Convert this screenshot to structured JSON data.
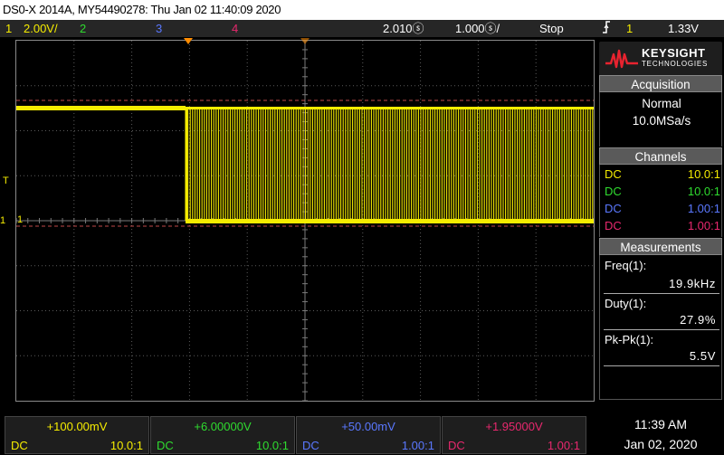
{
  "title_bar": "DS0-X 2014A, MY54490278: Thu Jan 02 11:40:09 2020",
  "status": {
    "ch1_num": "1",
    "ch1_scale": "2.00V/",
    "ch2_num": "2",
    "ch3_num": "3",
    "ch4_num": "4",
    "time_delay": "2.010ⓢ",
    "time_scale": "1.000ⓢ/",
    "run_state": "Stop",
    "trigger_icon": "trigger-edge-icon",
    "trigger_source": "1",
    "trigger_level": "1.33V"
  },
  "graticule": {
    "ch1_marker": "1",
    "ch1_marker_left": "1",
    "trigger_marker": "T"
  },
  "logo": {
    "brand": "KEYSIGHT",
    "sub": "TECHNOLOGIES"
  },
  "acquisition": {
    "header": "Acquisition",
    "mode": "Normal",
    "rate": "10.0MSa/s"
  },
  "channels": {
    "header": "Channels",
    "rows": [
      {
        "coupling": "DC",
        "probe": "10.0:1",
        "color": "#f5ec00"
      },
      {
        "coupling": "DC",
        "probe": "10.0:1",
        "color": "#2fdc2f"
      },
      {
        "coupling": "DC",
        "probe": "1.00:1",
        "color": "#5a78ff"
      },
      {
        "coupling": "DC",
        "probe": "1.00:1",
        "color": "#e8286e"
      }
    ]
  },
  "measurements": {
    "header": "Measurements",
    "items": [
      {
        "label": "Freq(1):",
        "value": "19.9kHz"
      },
      {
        "label": "Duty(1):",
        "value": "27.9%"
      },
      {
        "label": "Pk-Pk(1):",
        "value": "5.5V"
      }
    ]
  },
  "bottom_channels": [
    {
      "offset": "+100.00mV",
      "coupling": "DC",
      "probe": "10.0:1",
      "color": "#f5ec00"
    },
    {
      "offset": "+6.00000V",
      "coupling": "DC",
      "probe": "10.0:1",
      "color": "#2fdc2f"
    },
    {
      "offset": "+50.00mV",
      "coupling": "DC",
      "probe": "1.00:1",
      "color": "#5a78ff"
    },
    {
      "offset": "+1.95000V",
      "coupling": "DC",
      "probe": "1.00:1",
      "color": "#e8286e"
    }
  ],
  "clock": {
    "time": "11:39 AM",
    "date": "Jan 02, 2020"
  },
  "colors": {
    "ch1": "#f5ec00",
    "ch2": "#2fdc2f",
    "ch3": "#5a78ff",
    "ch4": "#e8286e",
    "trigger_marker": "#ff8c00"
  }
}
